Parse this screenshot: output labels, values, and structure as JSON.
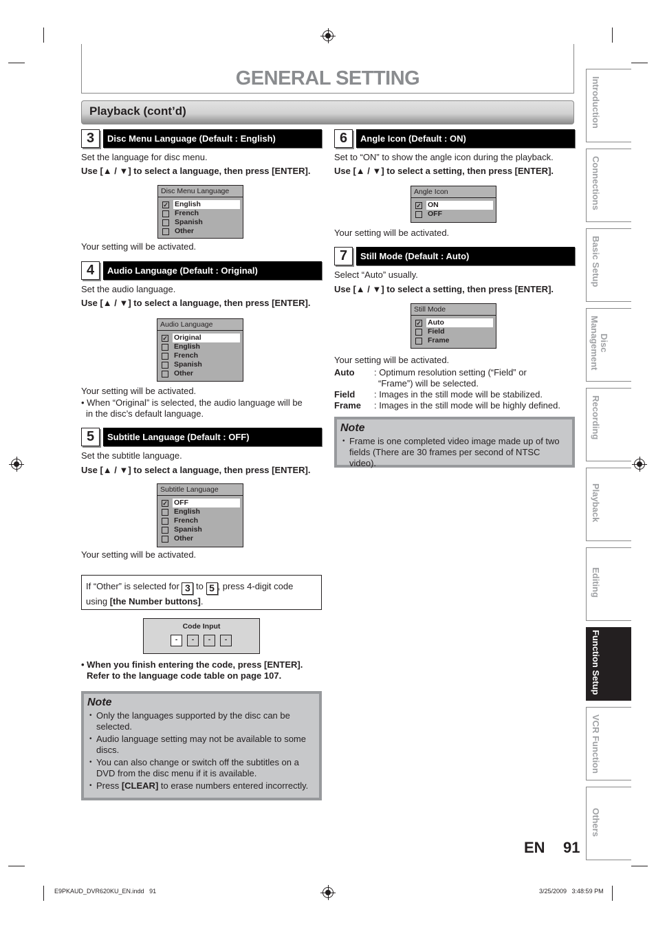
{
  "header": {
    "title": "GENERAL SETTING",
    "section": "Playback (cont’d)"
  },
  "steps": {
    "s3": {
      "num": "3",
      "title": "Disc Menu Language (Default : English)",
      "desc": "Set the language for disc menu.",
      "instruction": "Use [▲ / ▼] to select a language, then press [ENTER].",
      "menu": {
        "title": "Disc Menu Language",
        "items": [
          "English",
          "French",
          "Spanish",
          "Other"
        ],
        "selected": "English"
      },
      "result": "Your setting will be activated."
    },
    "s4": {
      "num": "4",
      "title": "Audio Language (Default : Original)",
      "desc": "Set the audio language.",
      "instruction": "Use [▲ / ▼] to select a language, then press [ENTER].",
      "menu": {
        "title": "Audio Language",
        "items": [
          "Original",
          "English",
          "French",
          "Spanish",
          "Other"
        ],
        "selected": "Original"
      },
      "result": "Your setting will be activated.",
      "bullet_1": "• When “Original” is selected, the audio language will be",
      "bullet_2": "in the disc’s default language."
    },
    "s5": {
      "num": "5",
      "title": "Subtitle Language (Default : OFF)",
      "desc": "Set the subtitle language.",
      "instruction": "Use [▲ / ▼] to select a language, then press [ENTER].",
      "menu": {
        "title": "Subtitle Language",
        "items": [
          "OFF",
          "English",
          "French",
          "Spanish",
          "Other"
        ],
        "selected": "OFF"
      },
      "result": "Your setting will be activated."
    },
    "s6": {
      "num": "6",
      "title": "Angle Icon (Default : ON)",
      "desc": "Set to “ON” to show the angle icon during the playback.",
      "instruction": "Use [▲ / ▼] to select a setting, then press [ENTER].",
      "menu": {
        "title": "Angle Icon",
        "items": [
          "ON",
          "OFF"
        ],
        "selected": "ON"
      },
      "result": "Your setting will be activated."
    },
    "s7": {
      "num": "7",
      "title": "Still Mode (Default : Auto)",
      "desc": "Select “Auto” usually.",
      "instruction": "Use [▲ / ▼] to select a setting, then press [ENTER].",
      "menu": {
        "title": "Still Mode",
        "items": [
          "Auto",
          "Field",
          "Frame"
        ],
        "selected": "Auto"
      },
      "result": "Your setting will be activated.",
      "definitions": [
        {
          "term": "Auto",
          "def_1": ": Optimum resolution setting (“Field” or",
          "def_2": "“Frame”) will be selected."
        },
        {
          "term": "Field",
          "def_1": ": Images in the still mode will be stabilized."
        },
        {
          "term": "Frame",
          "def_1": ": Images in the still mode will be highly defined."
        }
      ]
    }
  },
  "other_callout": {
    "part1": "If “Other” is selected for ",
    "num_a": "3",
    "part2": " to ",
    "num_b": "5",
    "part3": ", press 4-digit code",
    "part4": "using ",
    "bold": "[the Number buttons]",
    "part5": "."
  },
  "code_input": {
    "title": "Code Input",
    "slots": [
      "-",
      "-",
      "-",
      "-"
    ]
  },
  "code_hint": {
    "line1": "• When you finish entering the code, press [ENTER].",
    "line2": "Refer to the language code table on page 107."
  },
  "note_left": {
    "title": "Note",
    "items": [
      "Only the languages supported by the disc can be selected.",
      "Audio language setting may not be available to some discs.",
      "You can also change or switch off the subtitles on a DVD from the disc menu if it is available."
    ],
    "last_pre": "Press ",
    "last_bold": "[CLEAR]",
    "last_post": " to erase numbers entered incorrectly."
  },
  "note_right": {
    "title": "Note",
    "items": [
      "Frame is one completed video image made up of two fields (There are 30 frames per second of NTSC video)."
    ]
  },
  "side_tabs": [
    {
      "label": "Introduction",
      "active": false
    },
    {
      "label": "Connections",
      "active": false
    },
    {
      "label": "Basic Setup",
      "active": false
    },
    {
      "label": "Disc\nManagement",
      "active": false
    },
    {
      "label": "Recording",
      "active": false
    },
    {
      "label": "Playback",
      "active": false
    },
    {
      "label": "Editing",
      "active": false
    },
    {
      "label": "Function Setup",
      "active": true
    },
    {
      "label": "VCR Function",
      "active": false
    },
    {
      "label": "Others",
      "active": false
    }
  ],
  "footer": {
    "lang": "EN",
    "page": "91",
    "slug_left": "E9PKAUD_DVR620KU_EN.indd   91",
    "slug_right": "3/25/2009   3:48:59 PM"
  }
}
